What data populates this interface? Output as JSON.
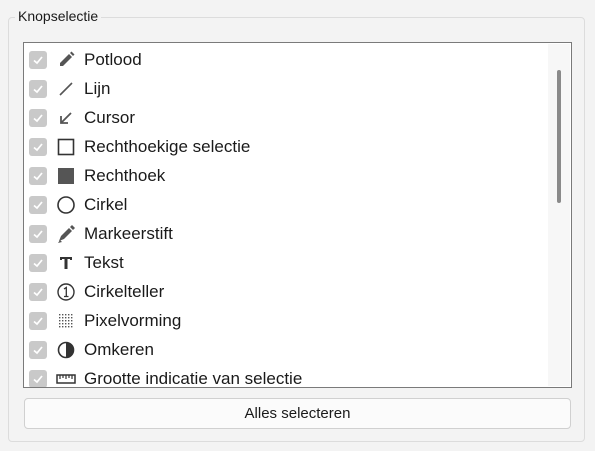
{
  "group": {
    "title": "Knopselectie"
  },
  "items": [
    {
      "label": "Potlood",
      "icon": "pencil-icon",
      "checked": true
    },
    {
      "label": "Lijn",
      "icon": "line-icon",
      "checked": true
    },
    {
      "label": "Cursor",
      "icon": "arrow-icon",
      "checked": true
    },
    {
      "label": "Rechthoekige selectie",
      "icon": "selection-rectangle-icon",
      "checked": true
    },
    {
      "label": "Rechthoek",
      "icon": "filled-rectangle-icon",
      "checked": true
    },
    {
      "label": "Cirkel",
      "icon": "circle-icon",
      "checked": true
    },
    {
      "label": "Markeerstift",
      "icon": "marker-icon",
      "checked": true
    },
    {
      "label": "Tekst",
      "icon": "text-icon",
      "checked": true
    },
    {
      "label": "Cirkelteller",
      "icon": "circle-counter-icon",
      "checked": true
    },
    {
      "label": "Pixelvorming",
      "icon": "pixelate-icon",
      "checked": true
    },
    {
      "label": "Omkeren",
      "icon": "invert-icon",
      "checked": true
    },
    {
      "label": "Grootte indicatie van selectie",
      "icon": "ruler-icon",
      "checked": true
    }
  ],
  "select_all_button": "Alles selecteren",
  "colors": {
    "checkbox_bg": "#c9c9c9",
    "icon": "#555555",
    "list_border": "#7a7a7a"
  }
}
